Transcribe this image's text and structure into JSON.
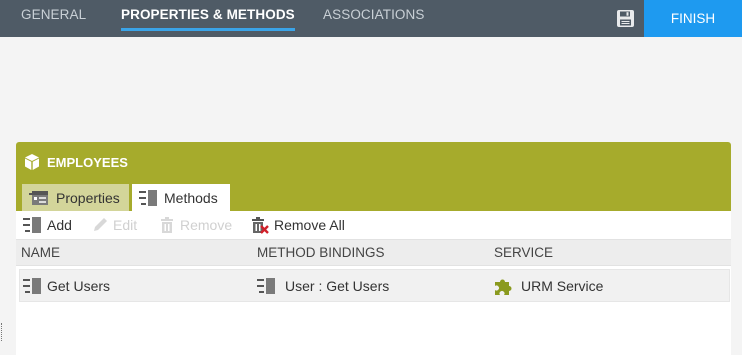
{
  "topbar": {
    "tabs": [
      {
        "label": "GENERAL"
      },
      {
        "label": "PROPERTIES & METHODS"
      },
      {
        "label": "ASSOCIATIONS"
      }
    ],
    "save_icon": "save-icon",
    "finish_label": "FINISH",
    "colors": {
      "bar": "#4f5b66",
      "accent": "#3aa4e8",
      "finish": "#1e9af0"
    }
  },
  "panel": {
    "title": "EMPLOYEES",
    "title_icon": "cube-icon",
    "header_color": "#a6ab2c",
    "tabs": [
      {
        "label": "Properties",
        "icon": "properties-icon"
      },
      {
        "label": "Methods",
        "icon": "methods-icon"
      }
    ],
    "toolbar": {
      "add": "Add",
      "edit": "Edit",
      "remove": "Remove",
      "remove_all": "Remove All"
    },
    "grid": {
      "columns": [
        "NAME",
        "METHOD BINDINGS",
        "SERVICE"
      ],
      "rows": [
        {
          "name": "Get Users",
          "binding": "User : Get Users",
          "service": "URM Service"
        }
      ]
    }
  }
}
